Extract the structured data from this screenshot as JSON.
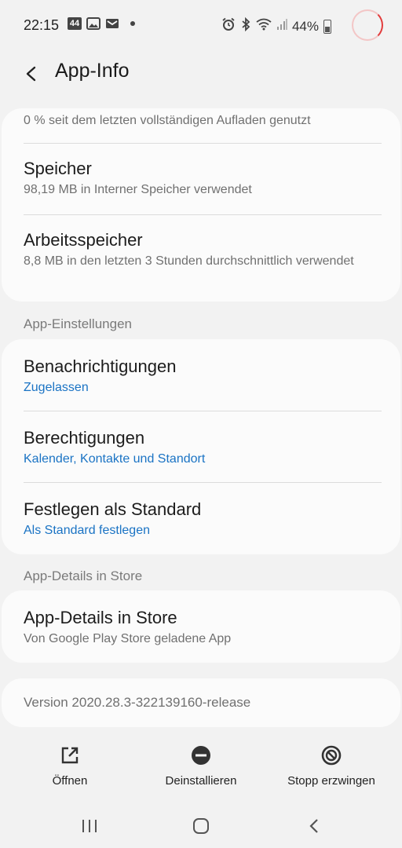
{
  "status": {
    "time": "22:15",
    "badge": "44",
    "battery": "44%"
  },
  "header": {
    "title": "App-Info"
  },
  "usage": {
    "battery_partial": "0 % seit dem letzten vollständigen Aufladen genutzt",
    "storage_title": "Speicher",
    "storage_sub": "98,19 MB in Interner Speicher verwendet",
    "memory_title": "Arbeitsspeicher",
    "memory_sub": "8,8 MB in den letzten 3 Stunden durchschnittlich verwendet"
  },
  "settings_section": {
    "header": "App-Einstellungen",
    "notifications_title": "Benachrichtigungen",
    "notifications_sub": "Zugelassen",
    "permissions_title": "Berechtigungen",
    "permissions_sub": "Kalender, Kontakte und Standort",
    "default_title": "Festlegen als Standard",
    "default_sub": "Als Standard festlegen"
  },
  "store_section": {
    "header": "App-Details in Store",
    "title": "App-Details in Store",
    "sub": "Von Google Play Store geladene App"
  },
  "version": "Version 2020.28.3-322139160-release",
  "actions": {
    "open": "Öffnen",
    "uninstall": "Deinstallieren",
    "force_stop": "Stopp erzwingen"
  },
  "colors": {
    "accent_blue": "#1a73c4",
    "background": "#f2f2f2",
    "card": "#fbfbfb"
  }
}
